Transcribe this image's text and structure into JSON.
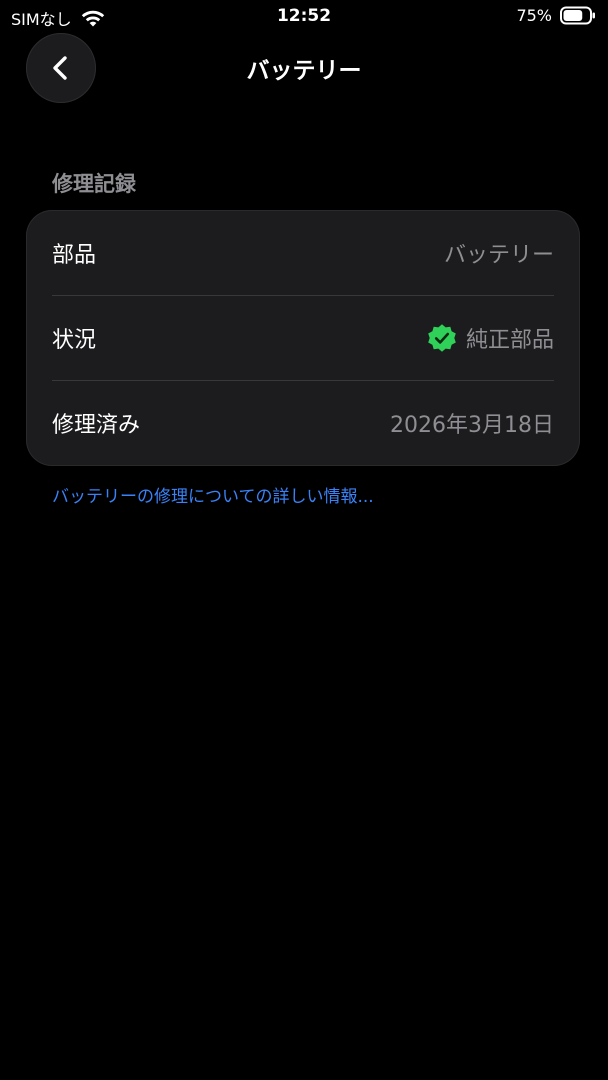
{
  "status_bar": {
    "carrier": "SIMなし",
    "time": "12:52",
    "battery_percent": "75%",
    "battery_level": 0.75
  },
  "nav": {
    "title": "バッテリー"
  },
  "section": {
    "header": "修理記録",
    "rows": [
      {
        "label": "部品",
        "value": "バッテリー"
      },
      {
        "label": "状況",
        "value": "純正部品"
      },
      {
        "label": "修理済み",
        "value": "2026年3月18日"
      }
    ]
  },
  "link": {
    "text": "バッテリーの修理についての詳しい情報..."
  },
  "colors": {
    "background": "#000000",
    "card": "#1c1c1e",
    "secondary_text": "#8e8e93",
    "link": "#3a82f7",
    "verified_green": "#30d158"
  },
  "icons": {
    "back": "chevron-left-icon",
    "wifi": "wifi-icon",
    "battery": "battery-icon",
    "verified": "verified-badge-icon"
  }
}
